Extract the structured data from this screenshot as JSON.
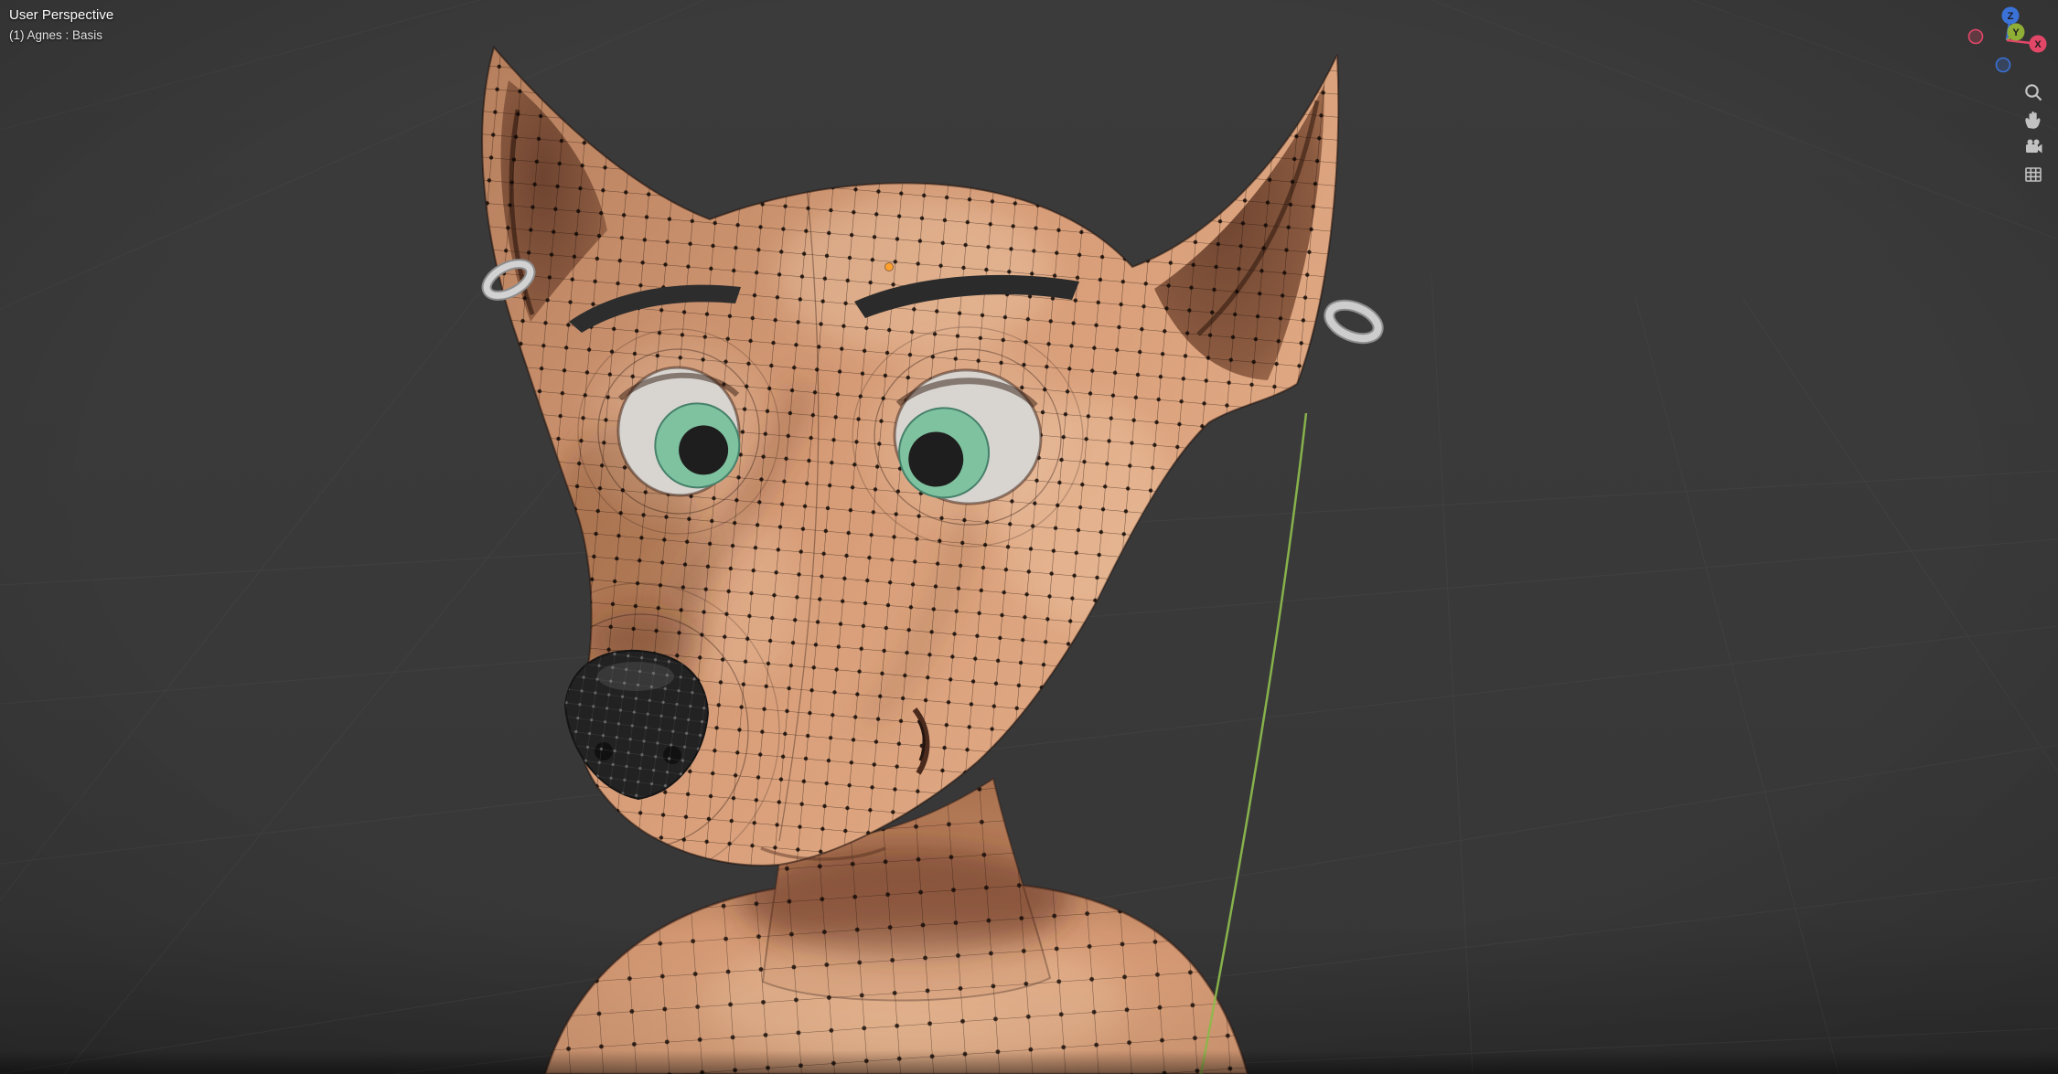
{
  "viewport": {
    "perspective_label": "User Perspective",
    "object_label": "(1) Agnes : Basis"
  },
  "gizmo": {
    "x_label": "X",
    "y_label": "Y",
    "z_label": "Z",
    "x_color": "#e24768",
    "y_color": "#8fae36",
    "z_color": "#3a72d8"
  },
  "nav_controls": {
    "zoom_icon": "magnifier-icon",
    "move_icon": "hand-icon",
    "camera_icon": "camera-icon",
    "ortho_icon": "grid-icon"
  },
  "scene": {
    "background_color": "#3a3a3a",
    "skin_color": "#d69c77",
    "wireframe_color": "#1a0f08",
    "iris_color": "#7fc2a0",
    "sclera_color": "#d8d5d0",
    "nose_color": "#222222",
    "bone_line_color": "#90c04e",
    "origin_dot_color": "#ffa02e",
    "earring_color": "#cfcfcf",
    "grid_line_color": "#4a4a4a"
  }
}
